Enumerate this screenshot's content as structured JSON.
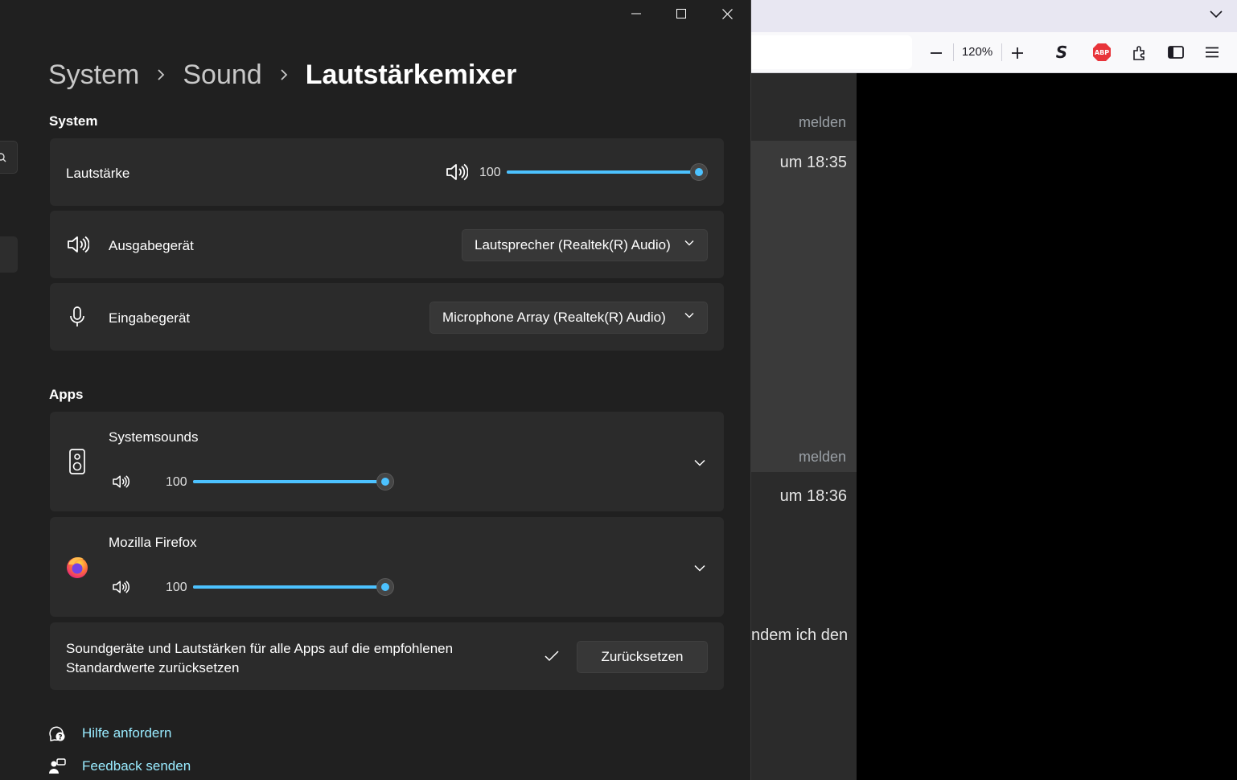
{
  "browser": {
    "zoom_level": "120%",
    "page": {
      "report_label_1": "melden",
      "time_1": "um 18:35",
      "report_label_2": "melden",
      "time_2": "um 18:36",
      "text_snippet": "ndem ich den"
    }
  },
  "settings": {
    "breadcrumb": {
      "item1": "System",
      "item2": "Sound",
      "current": "Lautstärkemixer"
    },
    "system_section": {
      "title": "System",
      "volume": {
        "label": "Lautstärke",
        "value": "100",
        "level": 100
      },
      "output": {
        "label": "Ausgabegerät",
        "selected": "Lautsprecher (Realtek(R) Audio)"
      },
      "input": {
        "label": "Eingabegerät",
        "selected": "Microphone Array (Realtek(R) Audio)"
      }
    },
    "apps_section": {
      "title": "Apps",
      "apps": [
        {
          "name": "Systemsounds",
          "value": "100",
          "level": 100
        },
        {
          "name": "Mozilla Firefox",
          "value": "100",
          "level": 100
        }
      ]
    },
    "reset": {
      "text_line1": "Soundgeräte und Lautstärken für alle Apps auf die empfohlenen",
      "text_line2": "Standardwerte zurücksetzen",
      "button_label": "Zurücksetzen"
    },
    "links": {
      "help": "Hilfe anfordern",
      "feedback": "Feedback senden"
    }
  },
  "colors": {
    "accent": "#4cc2ff",
    "link": "#99ebff",
    "background": "#202020",
    "card": "#2b2b2b"
  }
}
